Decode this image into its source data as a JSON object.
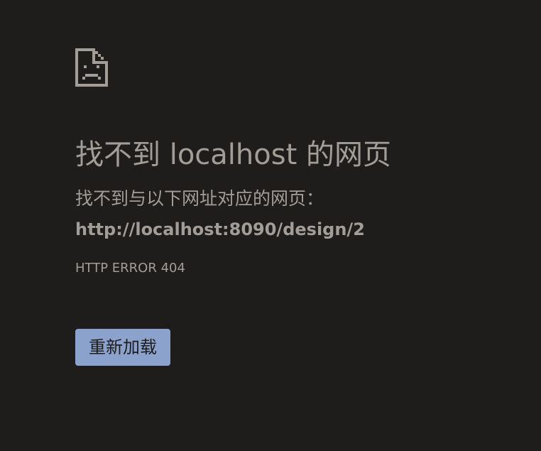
{
  "page": {
    "title": "找不到 localhost 的网页",
    "description": "找不到与以下网址对应的网页：",
    "url": "http://localhost:8090/design/2",
    "error_code": "HTTP ERROR 404"
  },
  "actions": {
    "reload_label": "重新加载"
  },
  "icons": {
    "error_icon": "sad-document-icon"
  },
  "colors": {
    "background": "#1f1d1c",
    "text": "#a39d98",
    "button": "#8ba3cc"
  }
}
